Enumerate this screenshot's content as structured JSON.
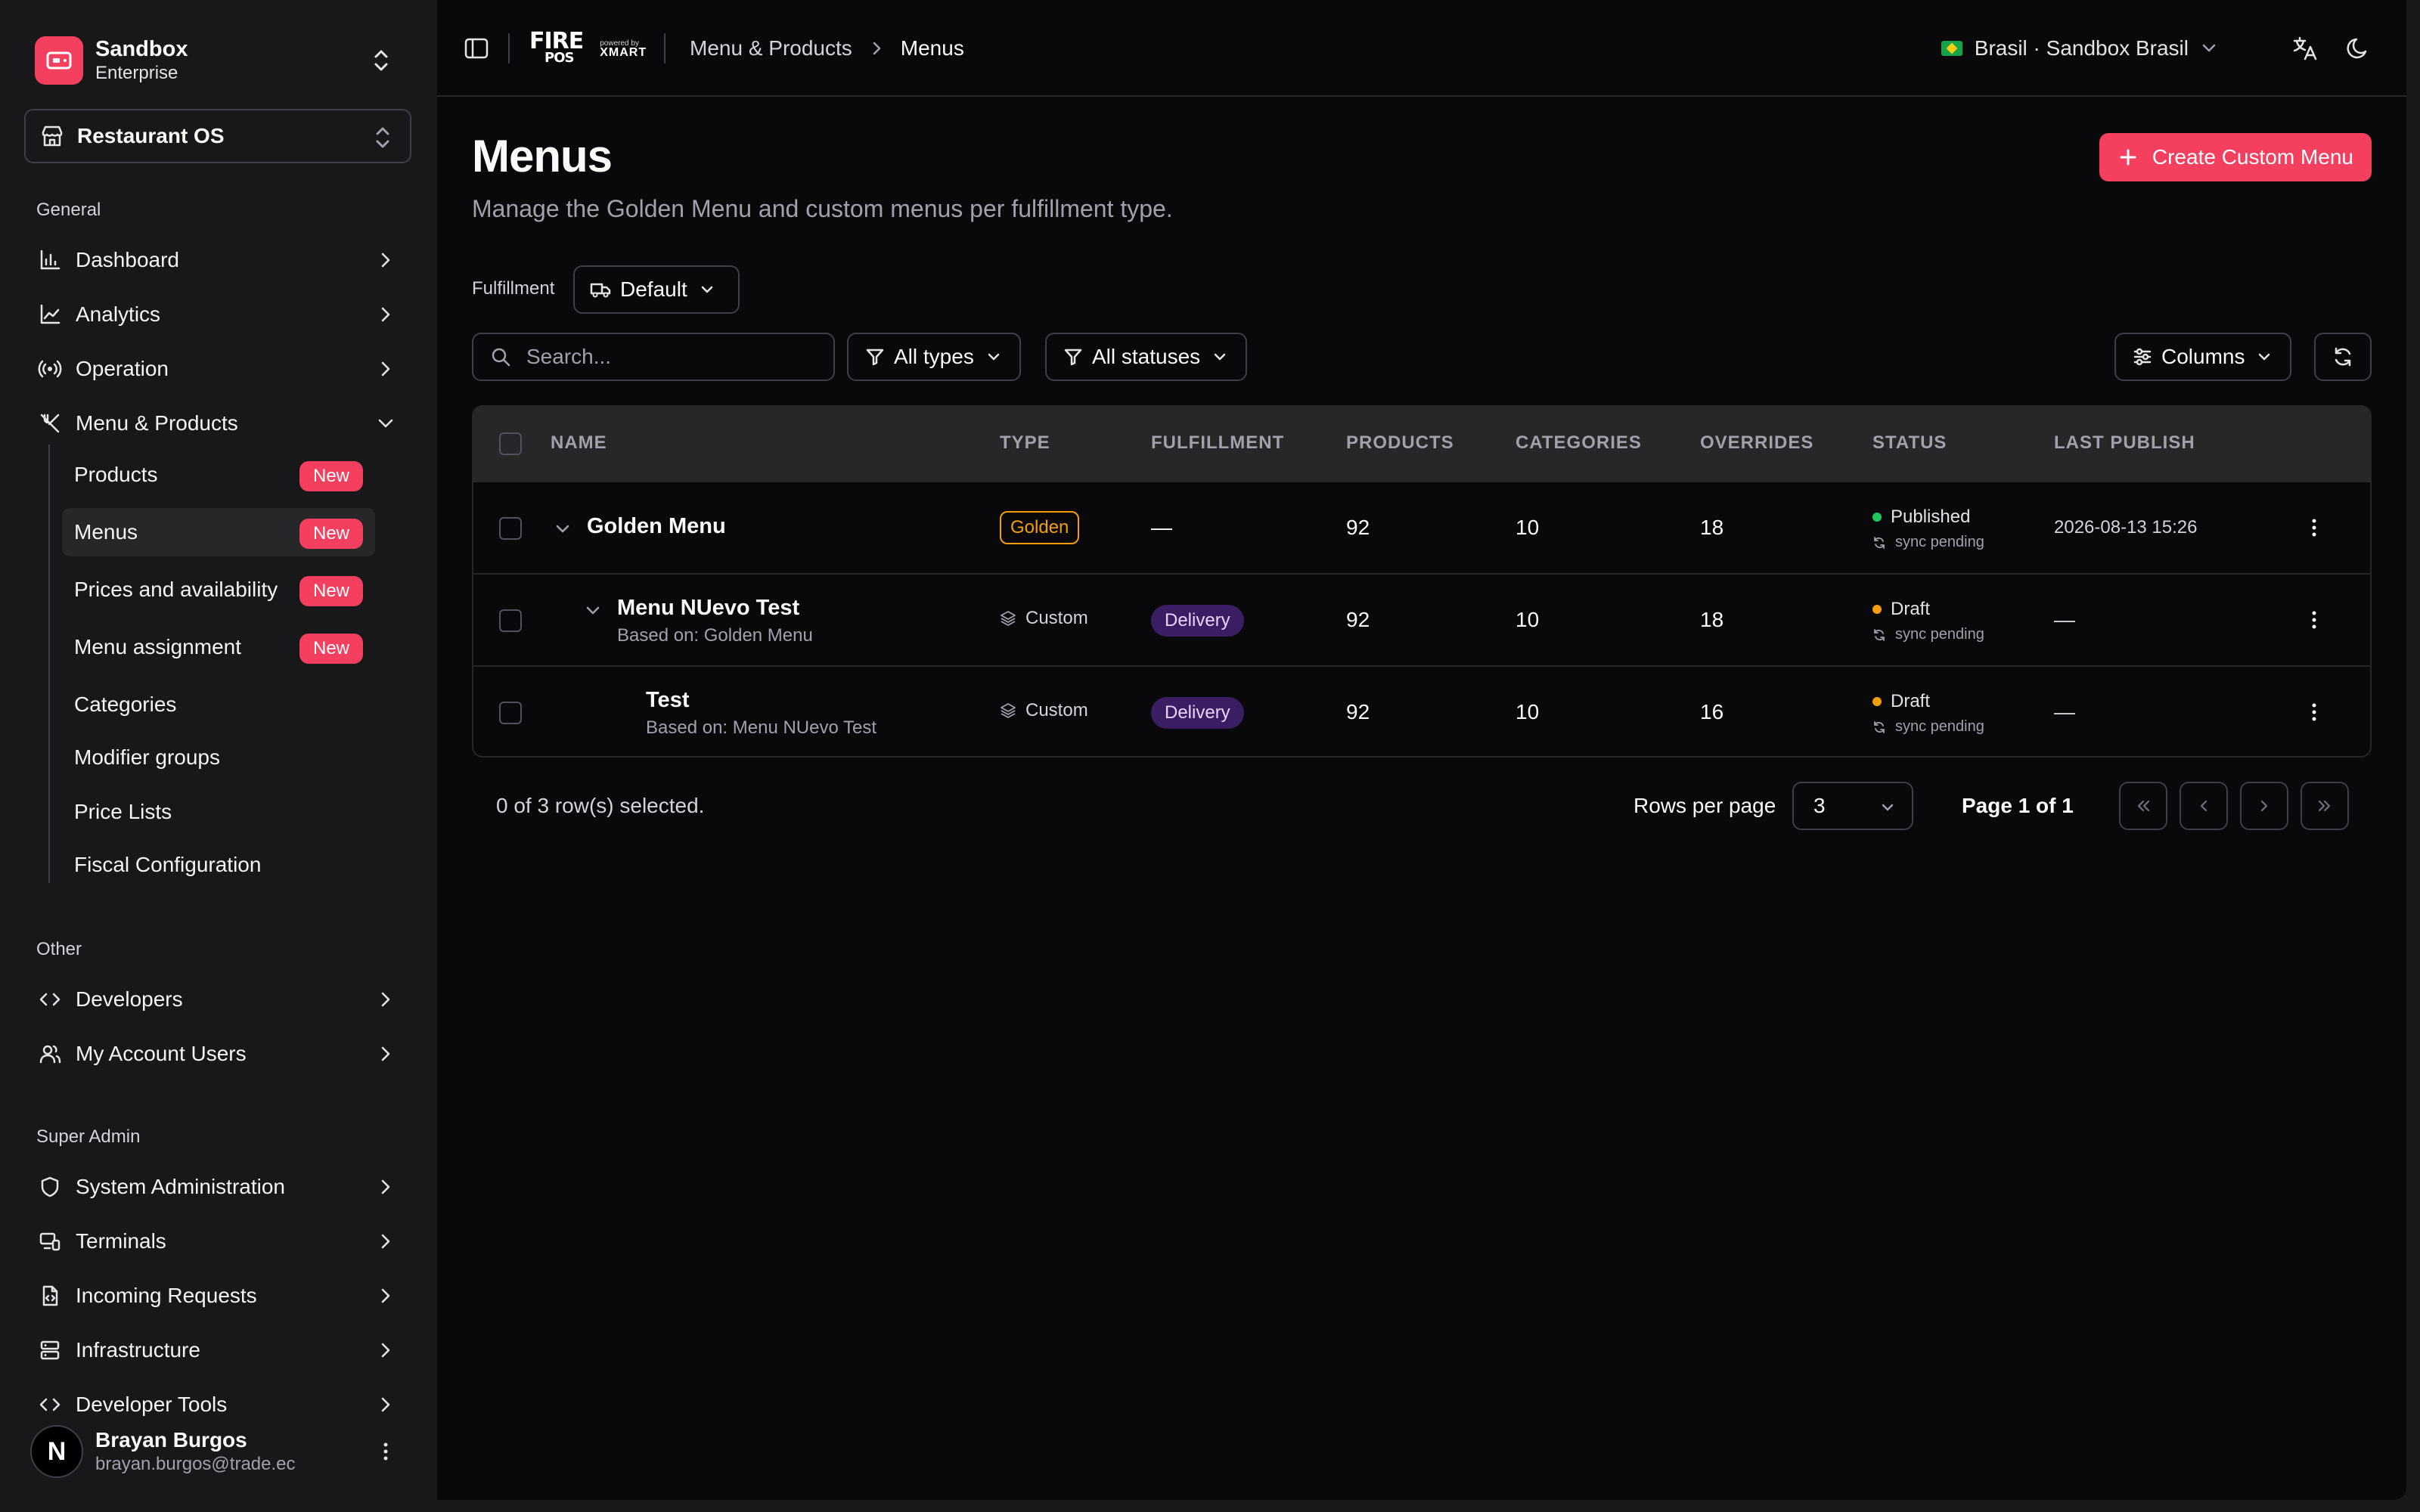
{
  "sidebar": {
    "org": {
      "name": "Sandbox",
      "plan": "Enterprise"
    },
    "app": {
      "label": "Restaurant OS"
    },
    "sections": {
      "general": "General",
      "other": "Other",
      "super_admin": "Super Admin"
    },
    "general_items": [
      {
        "label": "Dashboard",
        "icon": "bar-chart-icon"
      },
      {
        "label": "Analytics",
        "icon": "line-chart-icon"
      },
      {
        "label": "Operation",
        "icon": "radio-icon"
      },
      {
        "label": "Menu & Products",
        "icon": "utensils-icon"
      }
    ],
    "menu_sub_items": [
      {
        "label": "Products",
        "badge": "New"
      },
      {
        "label": "Menus",
        "badge": "New"
      },
      {
        "label": "Prices and availability",
        "badge": "New"
      },
      {
        "label": "Menu assignment",
        "badge": "New"
      },
      {
        "label": "Categories"
      },
      {
        "label": "Modifier groups"
      },
      {
        "label": "Price Lists"
      },
      {
        "label": "Fiscal Configuration"
      }
    ],
    "other_items": [
      {
        "label": "Developers",
        "icon": "code-icon"
      },
      {
        "label": "My Account Users",
        "icon": "users-icon"
      }
    ],
    "admin_items": [
      {
        "label": "System Administration",
        "icon": "shield-icon"
      },
      {
        "label": "Terminals",
        "icon": "monitor-icon"
      },
      {
        "label": "Incoming Requests",
        "icon": "file-code-icon"
      },
      {
        "label": "Infrastructure",
        "icon": "server-icon"
      },
      {
        "label": "Developer Tools",
        "icon": "code-icon"
      }
    ],
    "user": {
      "initial": "N",
      "name": "Brayan Burgos",
      "email": "brayan.burgos@trade.ec"
    }
  },
  "topbar": {
    "logo": {
      "fire": "FIRE",
      "pos": "POS",
      "powered": "powered by",
      "xmart": "XMART"
    },
    "breadcrumb": {
      "parent": "Menu & Products",
      "current": "Menus"
    },
    "region": "Brasil · Sandbox Brasil"
  },
  "page": {
    "title": "Menus",
    "subtitle": "Manage the Golden Menu and custom menus per fulfillment type.",
    "create_button": "Create Custom Menu",
    "fulfillment_label": "Fulfillment",
    "fulfillment_value": "Default",
    "search_placeholder": "Search...",
    "filter_types": "All types",
    "filter_statuses": "All statuses",
    "columns_button": "Columns"
  },
  "table": {
    "headers": [
      "NAME",
      "TYPE",
      "FULFILLMENT",
      "PRODUCTS",
      "CATEGORIES",
      "OVERRIDES",
      "STATUS",
      "LAST PUBLISH"
    ],
    "rows": [
      {
        "name": "Golden Menu",
        "sub": "",
        "type": "Golden",
        "fulfillment": "—",
        "products": "92",
        "categories": "10",
        "overrides": "18",
        "status": "Published",
        "sync": "sync pending",
        "last_publish": "2026-08-13 15:26"
      },
      {
        "name": "Menu NUevo Test",
        "sub": "Based on: Golden Menu",
        "type": "Custom",
        "fulfillment": "Delivery",
        "products": "92",
        "categories": "10",
        "overrides": "18",
        "status": "Draft",
        "sync": "sync pending",
        "last_publish": "—"
      },
      {
        "name": "Test",
        "sub": "Based on: Menu NUevo Test",
        "type": "Custom",
        "fulfillment": "Delivery",
        "products": "92",
        "categories": "10",
        "overrides": "16",
        "status": "Draft",
        "sync": "sync pending",
        "last_publish": "—"
      }
    ]
  },
  "pagination": {
    "selected": "0 of 3 row(s) selected.",
    "rows_per_page_label": "Rows per page",
    "rows_per_page": "3",
    "page_info": "Page 1 of 1"
  },
  "colors": {
    "accent": "#f43f5e",
    "golden": "#f59e0b",
    "published": "#22c55e",
    "draft": "#f59e0b",
    "delivery_bg": "#3b1d63"
  }
}
